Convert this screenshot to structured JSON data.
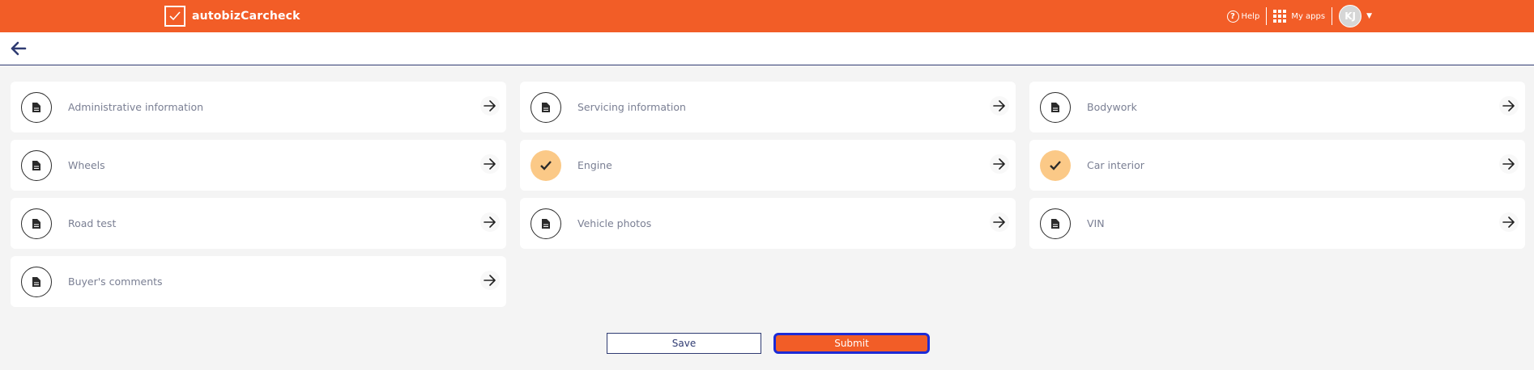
{
  "header": {
    "brand": "autobizCarcheck",
    "help_label": "Help",
    "apps_label": "My apps",
    "avatar_initials": "KJ",
    "bar_color": "#f25d27"
  },
  "sections": [
    {
      "label": "Administrative information",
      "status": "document-icon"
    },
    {
      "label": "Servicing information",
      "status": "document-icon"
    },
    {
      "label": "Bodywork",
      "status": "document-icon"
    },
    {
      "label": "Wheels",
      "status": "document-icon"
    },
    {
      "label": "Engine",
      "status": "check-icon"
    },
    {
      "label": "Car interior",
      "status": "check-icon"
    },
    {
      "label": "Road test",
      "status": "document-icon"
    },
    {
      "label": "Vehicle photos",
      "status": "document-icon"
    },
    {
      "label": "VIN",
      "status": "document-icon"
    },
    {
      "label": "Buyer's comments",
      "status": "document-icon"
    }
  ],
  "actions": {
    "save_label": "Save",
    "submit_label": "Submit"
  }
}
